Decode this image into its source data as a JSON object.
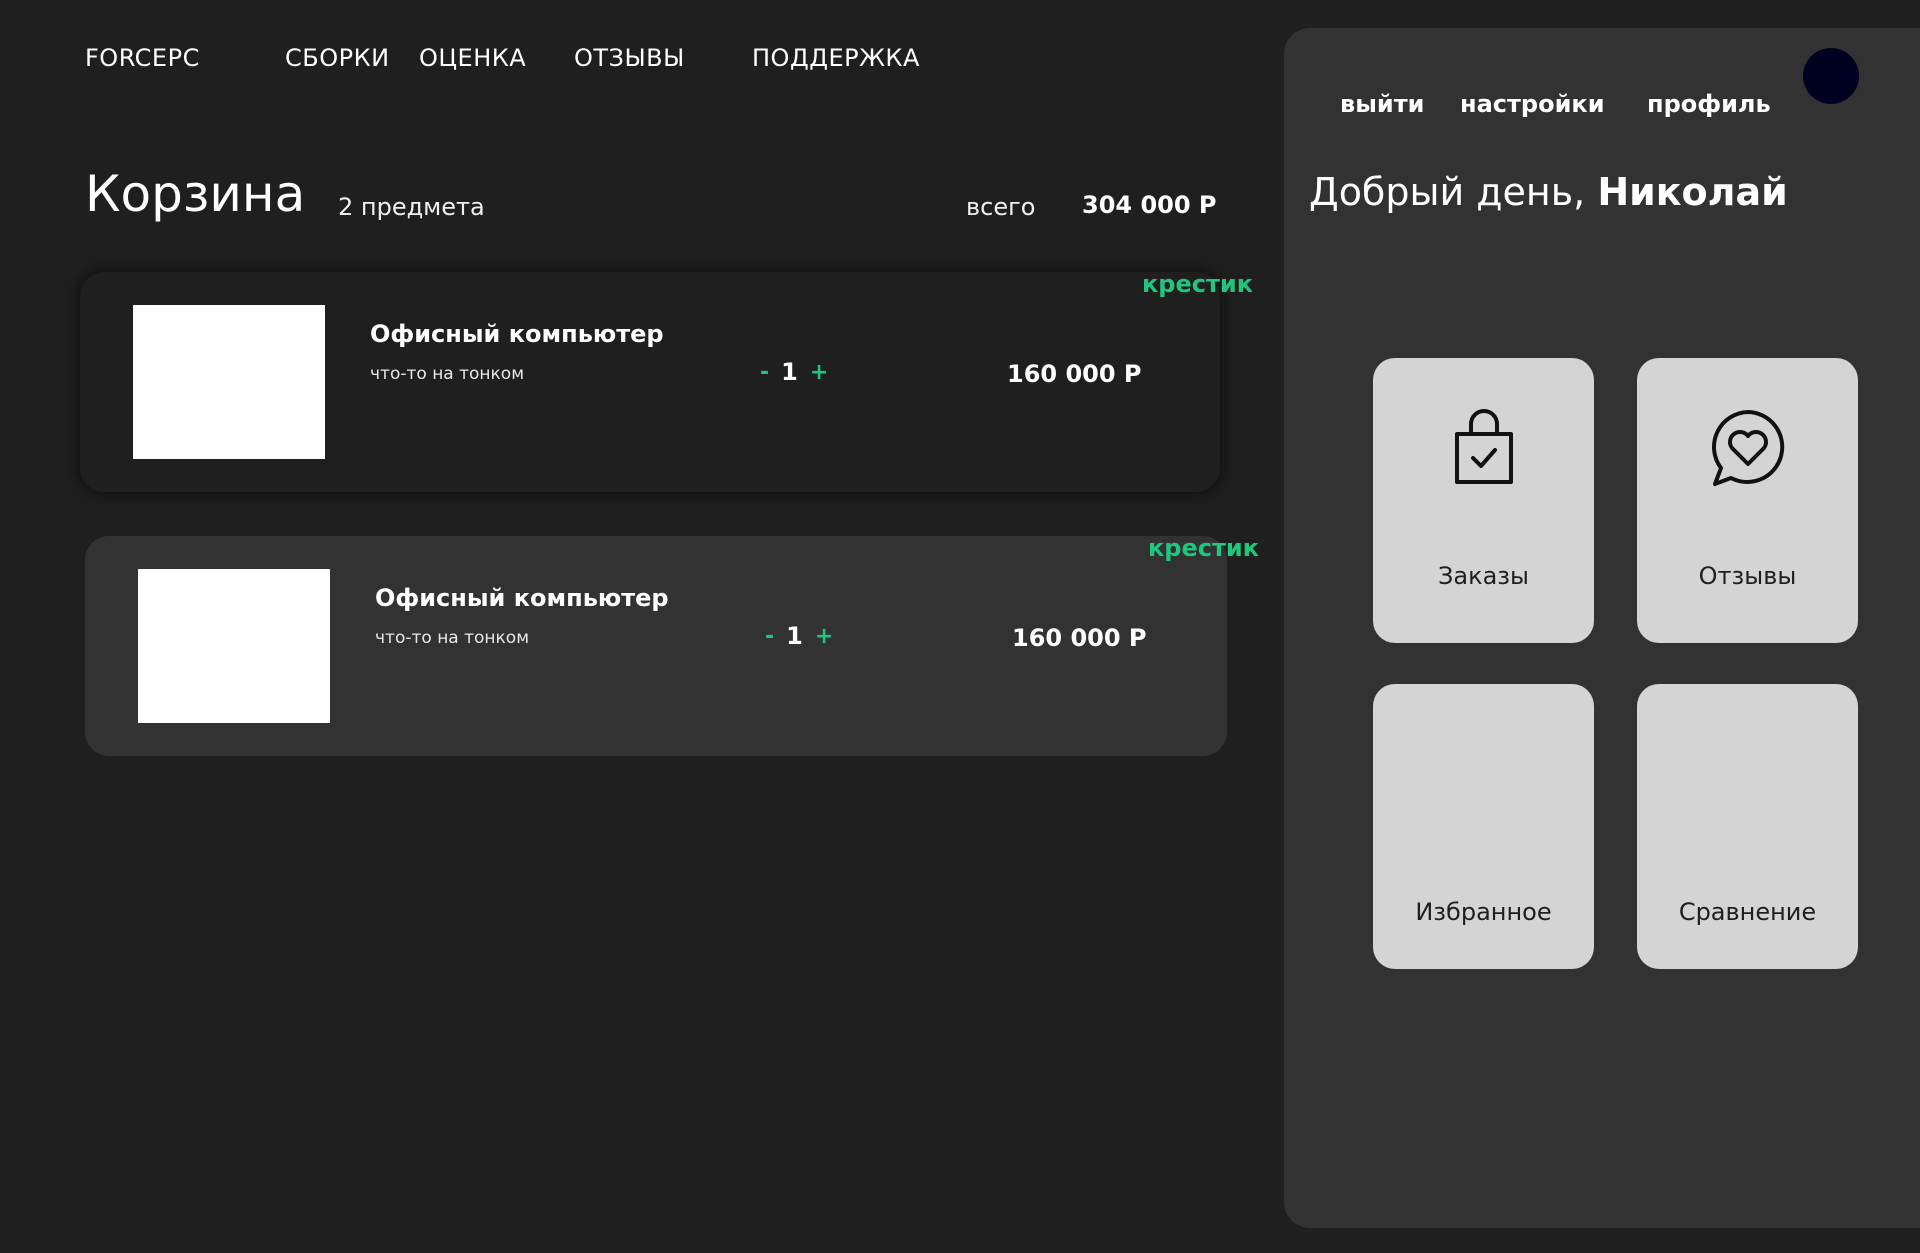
{
  "header": {
    "brand": "FORCEPC",
    "nav": [
      "СБОРКИ",
      "ОЦЕНКА",
      "ОТЗЫВЫ",
      "ПОДДЕРЖКА"
    ]
  },
  "cart": {
    "title": "Корзина",
    "count": "2 предмета",
    "total_label": "всего",
    "total_value": "304 000 Р",
    "items": [
      {
        "name": "Офисный компьютер",
        "description": "что-то на тонком",
        "qty": "1",
        "price": "160 000 Р",
        "minus": "-",
        "plus": "+",
        "remove": "крестик"
      },
      {
        "name": "Офисный компьютер",
        "description": "что-то на тонком",
        "qty": "1",
        "price": "160 000 Р",
        "minus": "-",
        "plus": "+",
        "remove": "крестик"
      }
    ]
  },
  "panel": {
    "logout": "выйти",
    "settings": "настройки",
    "profile": "профиль",
    "greeting_prefix": "Добрый день, ",
    "user_name": "Николай",
    "tiles": [
      {
        "label": "Заказы",
        "icon": "shopping-bag-icon"
      },
      {
        "label": "Отзывы",
        "icon": "heart-chat-icon"
      },
      {
        "label": "Избранное",
        "icon": ""
      },
      {
        "label": "Сравнение",
        "icon": ""
      }
    ]
  },
  "colors": {
    "background": "#1f1f1f",
    "panel": "#323232",
    "accent": "#1fc77e",
    "tile": "#d4d4d4"
  }
}
